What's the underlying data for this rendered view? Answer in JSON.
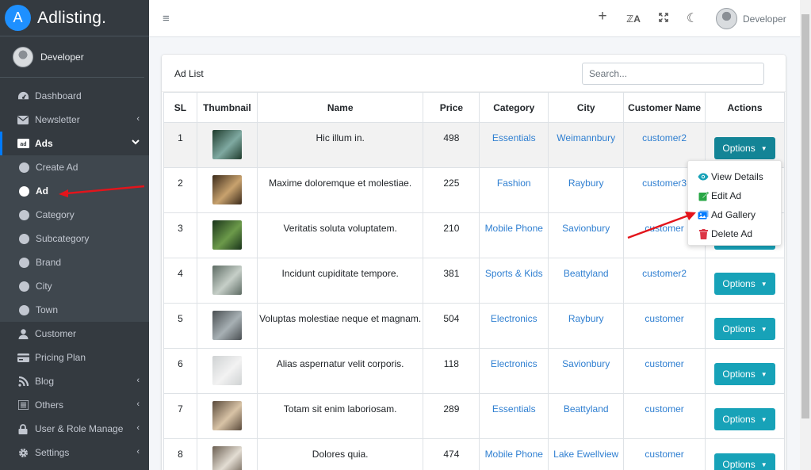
{
  "brand": {
    "logo_letter": "A",
    "name": "Adlisting."
  },
  "sidebar": {
    "user": "Developer",
    "items": [
      {
        "label": "Dashboard",
        "icon": "tachometer-icon"
      },
      {
        "label": "Newsletter",
        "icon": "envelope-icon",
        "chevron": "‹"
      },
      {
        "label": "Ads",
        "icon": "ad-icon",
        "chevron": "⌄",
        "open": true
      }
    ],
    "ads_submenu": [
      "Create Ad",
      "Ad",
      "Category",
      "Subcategory",
      "Brand",
      "City",
      "Town"
    ],
    "items_after": [
      {
        "label": "Customer",
        "icon": "user-icon"
      },
      {
        "label": "Pricing Plan",
        "icon": "credit-card-icon"
      },
      {
        "label": "Blog",
        "icon": "blog-icon",
        "chevron": "‹"
      },
      {
        "label": "Others",
        "icon": "list-icon",
        "chevron": "‹"
      },
      {
        "label": "User & Role Manage",
        "icon": "lock-icon",
        "chevron": "‹"
      },
      {
        "label": "Settings",
        "icon": "cog-icon",
        "chevron": "‹"
      }
    ]
  },
  "topbar": {
    "hamburger": "≡",
    "plus": "+",
    "translate": "ℤA",
    "expand": "⛶",
    "moon": "☾",
    "user": "Developer"
  },
  "card": {
    "title": "Ad List",
    "search_placeholder": "Search...",
    "columns": [
      "SL",
      "Thumbnail",
      "Name",
      "Price",
      "Category",
      "City",
      "Customer Name",
      "Actions"
    ],
    "rows": [
      {
        "sl": "1",
        "name": "Hic illum in.",
        "price": "498",
        "category": "Essentials",
        "city": "Weimannbury",
        "customer": "customer2",
        "thumb_colors": [
          "#1f3b2c",
          "#7fa9a1"
        ]
      },
      {
        "sl": "2",
        "name": "Maxime doloremque et molestiae.",
        "price": "225",
        "category": "Fashion",
        "city": "Raybury",
        "customer": "customer3",
        "thumb_colors": [
          "#3b2a1a",
          "#c8a26e"
        ]
      },
      {
        "sl": "3",
        "name": "Veritatis soluta voluptatem.",
        "price": "210",
        "category": "Mobile Phone",
        "city": "Savionbury",
        "customer": "customer",
        "thumb_colors": [
          "#19331a",
          "#6c9a4a"
        ]
      },
      {
        "sl": "4",
        "name": "Incidunt cupiditate tempore.",
        "price": "381",
        "category": "Sports & Kids",
        "city": "Beattyland",
        "customer": "customer2",
        "thumb_colors": [
          "#5d6b63",
          "#c6cfc8"
        ]
      },
      {
        "sl": "5",
        "name": "Voluptas molestiae neque et magnam.",
        "price": "504",
        "category": "Electronics",
        "city": "Raybury",
        "customer": "customer",
        "thumb_colors": [
          "#4a4f52",
          "#a7b0b4"
        ]
      },
      {
        "sl": "6",
        "name": "Alias aspernatur velit corporis.",
        "price": "118",
        "category": "Electronics",
        "city": "Savionbury",
        "customer": "customer",
        "thumb_colors": [
          "#cfd2d3",
          "#f2f2f2"
        ]
      },
      {
        "sl": "7",
        "name": "Totam sit enim laboriosam.",
        "price": "289",
        "category": "Essentials",
        "city": "Beattyland",
        "customer": "customer",
        "thumb_colors": [
          "#5a4a3b",
          "#d8c3a6"
        ]
      },
      {
        "sl": "8",
        "name": "Dolores quia.",
        "price": "474",
        "category": "Mobile Phone",
        "city": "Lake Ewellview",
        "customer": "customer",
        "thumb_colors": [
          "#6b5f52",
          "#e3ddd3"
        ]
      }
    ],
    "options_label": "Options",
    "caret": "▼"
  },
  "dropdown": [
    {
      "label": "View Details",
      "icon": "eye-icon",
      "color": "#17a2b8"
    },
    {
      "label": "Edit Ad",
      "icon": "edit-icon",
      "color": "#28a745"
    },
    {
      "label": "Ad Gallery",
      "icon": "images-icon",
      "color": "#007bff"
    },
    {
      "label": "Delete Ad",
      "icon": "trash-icon",
      "color": "#dc3545"
    }
  ],
  "colors": {
    "sidebar": "#343a40",
    "accent": "#17a2b8",
    "link": "#2f7fd1",
    "annotation": "#e3141b"
  }
}
